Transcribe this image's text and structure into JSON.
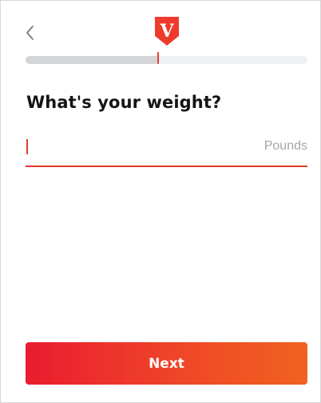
{
  "header": {
    "back_icon": "chevron-left-icon",
    "logo_icon": "brand-v-shield-logo",
    "logo_letter": "V"
  },
  "progress": {
    "fraction": 0.47
  },
  "main": {
    "title": "What's your weight?",
    "weight_input": {
      "value": "",
      "unit": "Pounds"
    }
  },
  "footer": {
    "next_label": "Next"
  },
  "colors": {
    "accent": "#e33a31",
    "title_text": "#151515",
    "placeholder": "#a6a6a6",
    "progress_track": "#eef0f3",
    "progress_fill": "#d3d5d9",
    "button_gradient_start": "#ea1c2f",
    "button_gradient_end": "#f0621f"
  }
}
